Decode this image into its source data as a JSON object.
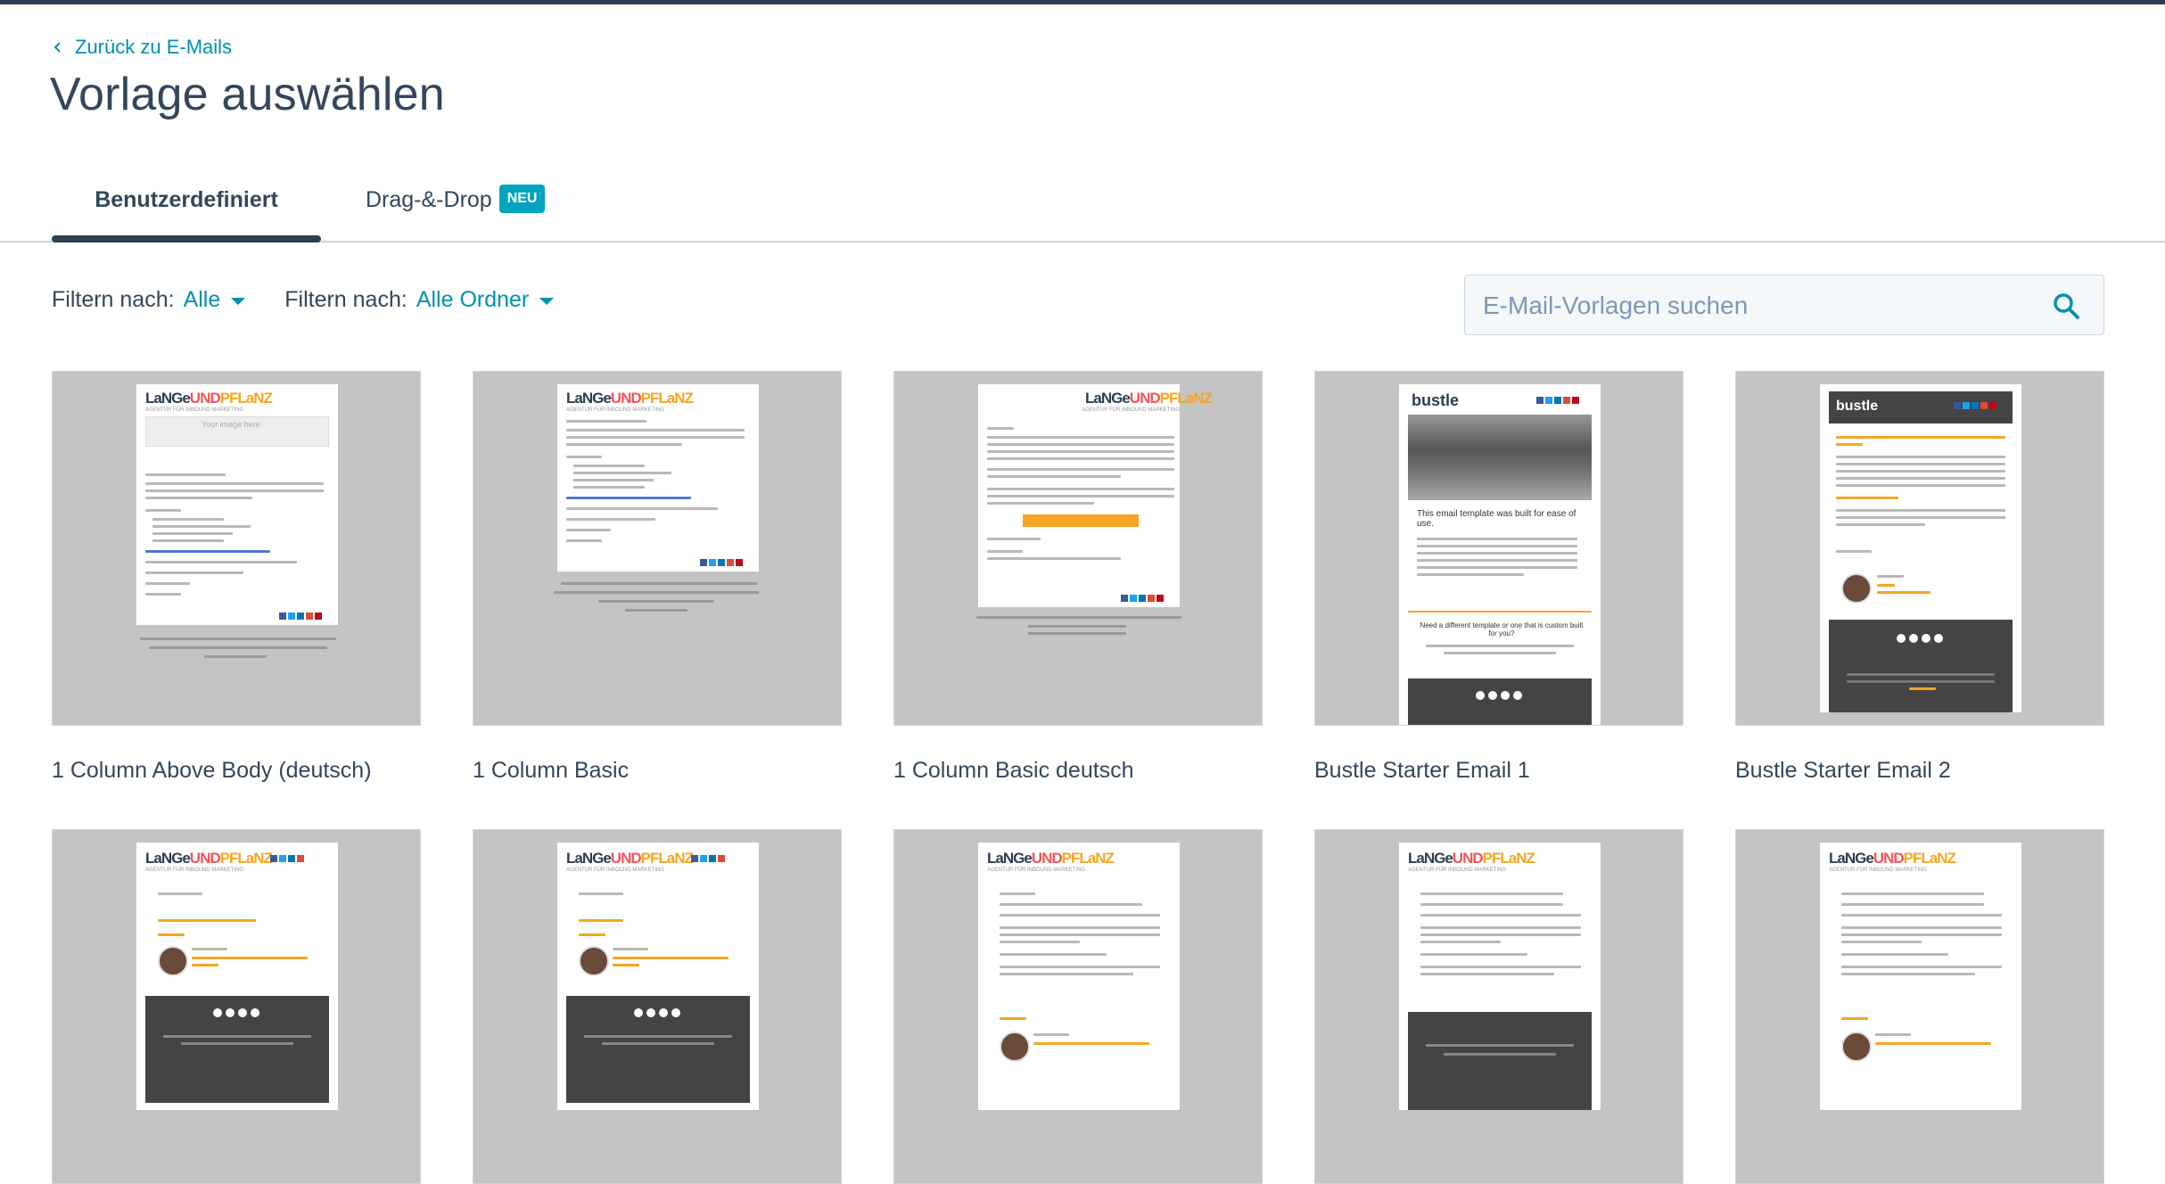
{
  "nav": {
    "back_label": "Zurück zu E-Mails"
  },
  "page": {
    "title": "Vorlage auswählen"
  },
  "tabs": [
    {
      "label": "Benutzerdefiniert",
      "active": true
    },
    {
      "label": "Drag-&-Drop",
      "badge": "NEU",
      "active": false
    }
  ],
  "filters": [
    {
      "label": "Filtern nach:",
      "value": "Alle"
    },
    {
      "label": "Filtern nach:",
      "value": "Alle Ordner"
    }
  ],
  "search": {
    "placeholder": "E-Mail-Vorlagen suchen",
    "value": ""
  },
  "templates": [
    {
      "name": "1 Column Above Body (deutsch)"
    },
    {
      "name": "1 Column Basic"
    },
    {
      "name": "1 Column Basic deutsch"
    },
    {
      "name": "Bustle Starter Email 1"
    },
    {
      "name": "Bustle Starter Email 2"
    }
  ],
  "thumb_text": {
    "logo_a": "LaNGe",
    "logo_b": "UND",
    "logo_c": "PFLaNZ",
    "logo_tagline": "AGENTUR FÜR INBOUND MARKETING",
    "image_placeholder": "Your image here",
    "bustle_logo": "bustle",
    "bustle_headline": "This email template was built for ease of use.",
    "bustle_headline_2": "Need a different template or one that is custom built for you?"
  },
  "colors": {
    "accent": "#0091ae",
    "header_dark": "#2d3e50",
    "badge": "#00a4bd",
    "thumb_bg": "#c4c4c4",
    "brand_orange": "#f5a623",
    "brand_red": "#f2545b"
  }
}
